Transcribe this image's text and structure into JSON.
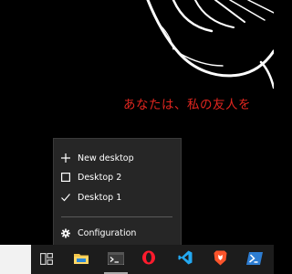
{
  "wallpaper": {
    "text": "あなたは、私の友人を",
    "text_color": "#e0261f"
  },
  "task_view_menu": {
    "items": [
      {
        "label": "New desktop",
        "icon": "plus-icon"
      },
      {
        "label": "Desktop 2",
        "icon": "desktop-icon"
      },
      {
        "label": "Desktop 1",
        "icon": "check-icon",
        "active": true
      },
      {
        "label": "Configuration",
        "icon": "gear-icon"
      }
    ]
  },
  "taskbar": {
    "apps": [
      {
        "name": "task-view",
        "icon": "task-view-icon"
      },
      {
        "name": "file-explorer",
        "icon": "folder-icon"
      },
      {
        "name": "terminal",
        "icon": "terminal-icon"
      },
      {
        "name": "opera",
        "icon": "opera-icon"
      },
      {
        "name": "vscode",
        "icon": "vscode-icon"
      },
      {
        "name": "brave",
        "icon": "brave-icon"
      },
      {
        "name": "powershell",
        "icon": "powershell-icon"
      }
    ],
    "accent_color": "#0078d4"
  }
}
